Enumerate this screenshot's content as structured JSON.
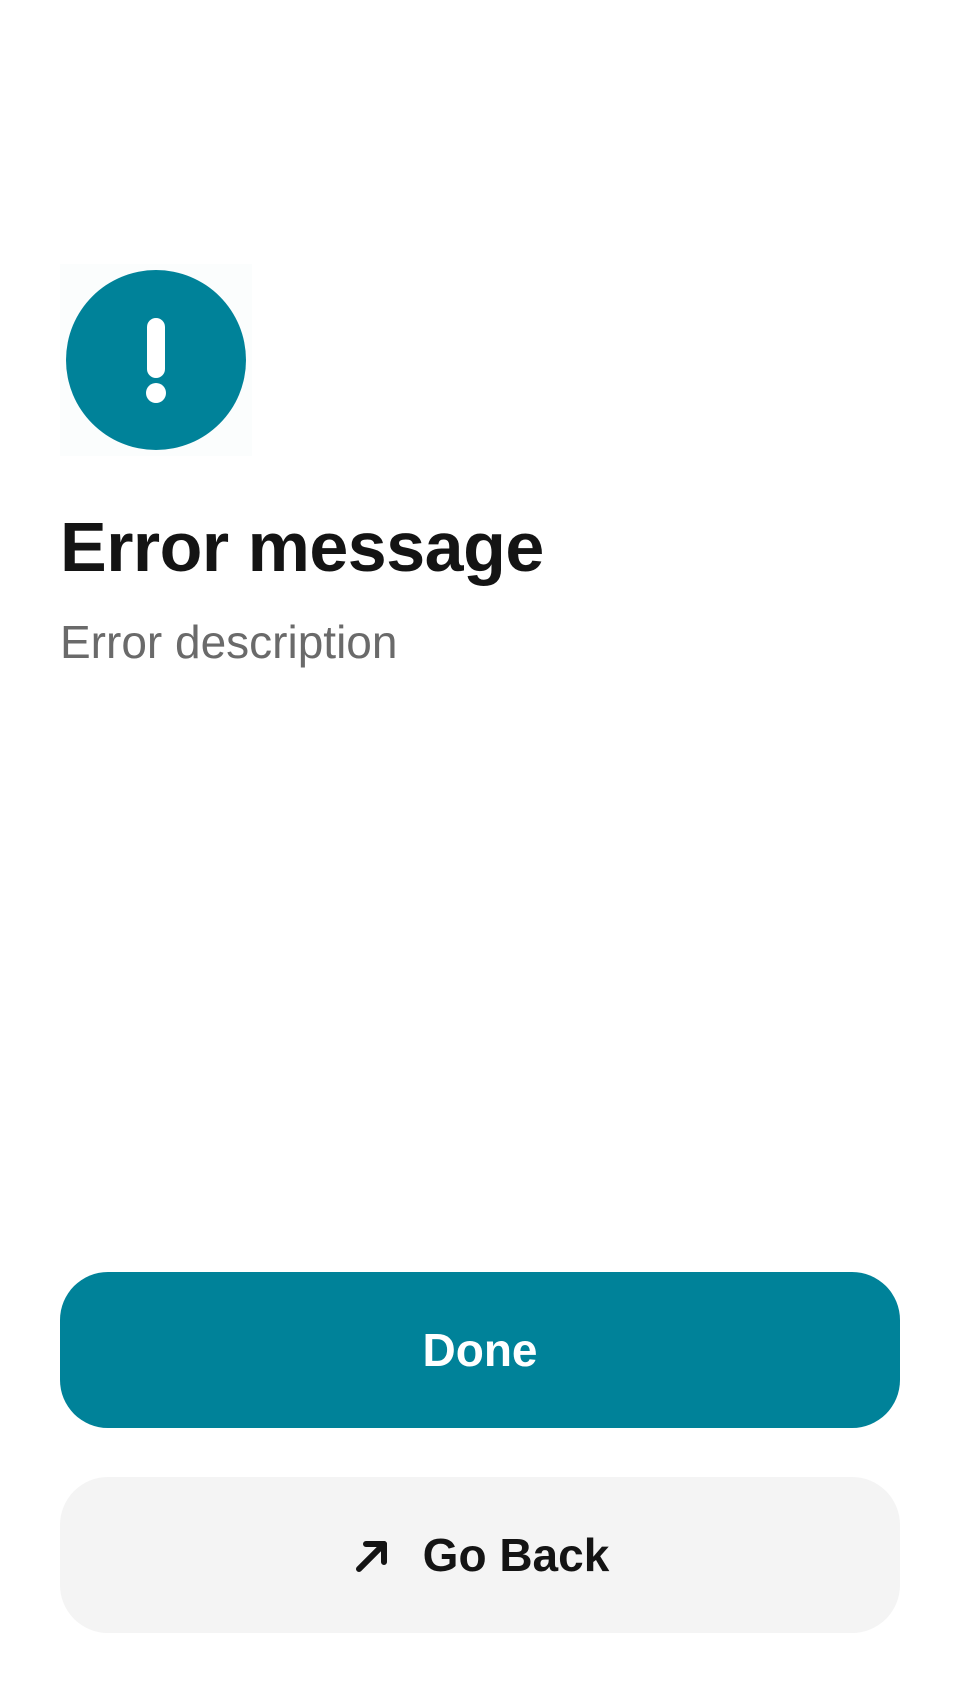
{
  "error": {
    "icon": "exclamation-circle-icon",
    "accent_color": "#008299",
    "title": "Error message",
    "description": "Error description"
  },
  "actions": {
    "primary_label": "Done",
    "secondary_label": "Go Back",
    "secondary_icon": "arrow-up-right-icon",
    "secondary_background": "#f4f4f4"
  }
}
